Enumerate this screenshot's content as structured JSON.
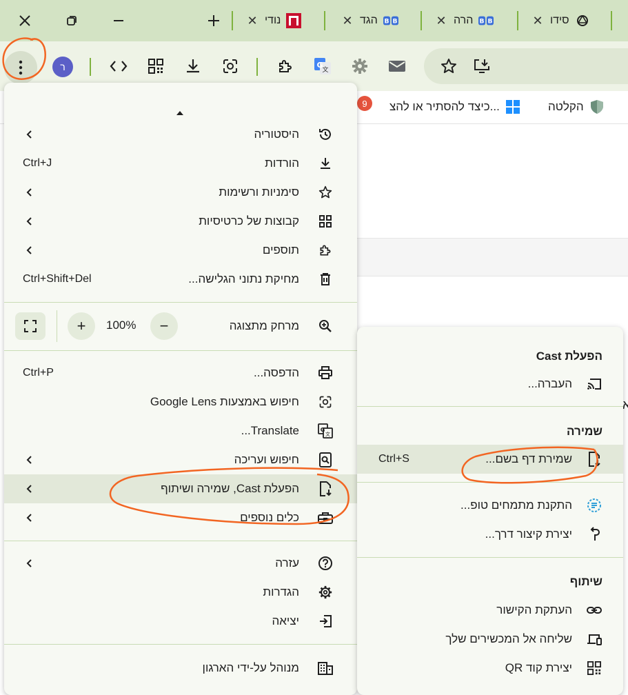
{
  "tabs": [
    {
      "title": "סידו",
      "favicon": "openai-icon"
    },
    {
      "title": "הרה",
      "favicon": "bb-icon"
    },
    {
      "title": "הגד",
      "favicon": "bb-icon"
    },
    {
      "title": "נודי",
      "favicon": "n-logo-icon"
    }
  ],
  "toolbar": {
    "avatar_letter": "ר"
  },
  "bookmarks": [
    {
      "label": "הקלטה"
    },
    {
      "label": "כיצד להסתיר או להצ..."
    }
  ],
  "bookmark_badge": "9",
  "menu": {
    "items": [
      {
        "label": "היסטוריה",
        "shortcut": "",
        "has_sub": true
      },
      {
        "label": "הורדות",
        "shortcut": "Ctrl+J",
        "has_sub": false
      },
      {
        "label": "סימניות ורשימות",
        "shortcut": "",
        "has_sub": true
      },
      {
        "label": "קבוצות של כרטיסיות",
        "shortcut": "",
        "has_sub": true
      },
      {
        "label": "תוספים",
        "shortcut": "",
        "has_sub": true
      },
      {
        "label": "מחיקת נתוני הגלישה...",
        "shortcut": "Ctrl+Shift+Del",
        "has_sub": false
      },
      {
        "label": "מרחק מתצוגה",
        "shortcut": "",
        "has_sub": false
      },
      {
        "label": "הדפסה...",
        "shortcut": "Ctrl+P",
        "has_sub": false
      },
      {
        "label": "חיפוש באמצעות Google Lens",
        "shortcut": "",
        "has_sub": false
      },
      {
        "label": "Translate...",
        "shortcut": "",
        "has_sub": false
      },
      {
        "label": "חיפוש ועריכה",
        "shortcut": "",
        "has_sub": true
      },
      {
        "label": "הפעלת Cast, שמירה ושיתוף",
        "shortcut": "",
        "has_sub": true
      },
      {
        "label": "כלים נוספים",
        "shortcut": "",
        "has_sub": true
      },
      {
        "label": "עזרה",
        "shortcut": "",
        "has_sub": true
      },
      {
        "label": "הגדרות",
        "shortcut": "",
        "has_sub": false
      },
      {
        "label": "יציאה",
        "shortcut": "",
        "has_sub": false
      },
      {
        "label": "מנוהל על-ידי הארגון",
        "shortcut": "",
        "has_sub": false
      }
    ],
    "zoom_value": "100%",
    "zoom_minus": "−",
    "zoom_plus": "+"
  },
  "submenu": {
    "cast_header": "הפעלת Cast",
    "cast_item": "העברה...",
    "save_header": "שמירה",
    "save_page": "שמירת דף בשם...",
    "save_shortcut": "Ctrl+S",
    "install_fonts": "התקנת מתמחים טופ...",
    "create_shortcut": "יצירת קיצור דרך...",
    "share_header": "שיתוף",
    "copy_link": "העתקת הקישור",
    "send_devices": "שליחה אל המכשירים שלך",
    "qr_code": "יצירת קוד QR"
  },
  "page": {
    "edge_char": "א"
  },
  "colors": {
    "tab_strip": "#d3e3c4",
    "toolbar": "#eef3e6",
    "accent": "#7fb23f",
    "annotation": "#f26522",
    "menu_bg": "#f7f9f3",
    "menu_highlight": "#e2e8d9"
  }
}
